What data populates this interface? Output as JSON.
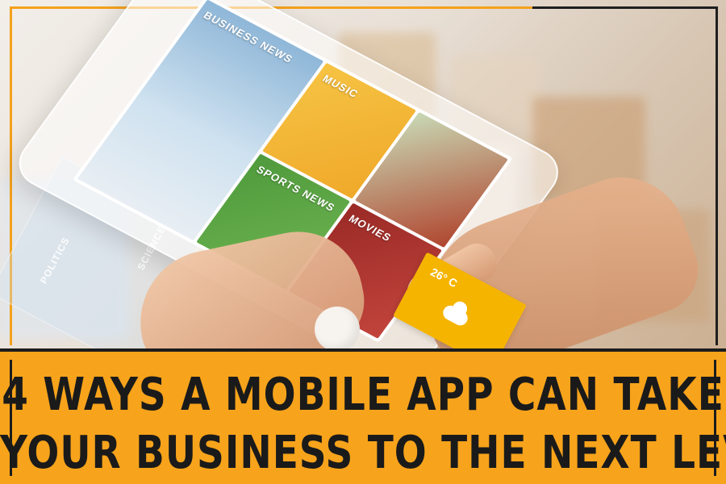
{
  "title": {
    "line1": "4 WAYS A MOBILE APP CAN TAKE",
    "line2": "YOUR BUSINESS TO THE NEXT LEVEL"
  },
  "phone_screen": {
    "tiles": [
      {
        "label": "BUSINESS NEWS"
      },
      {
        "label": "MUSIC"
      },
      {
        "label": "SPORTS NEWS"
      },
      {
        "label": "MOVIES"
      }
    ]
  },
  "side_panel": {
    "labels": [
      "SCIENCE",
      "POLITICS"
    ]
  },
  "weather_widget": {
    "temp": "26° C",
    "icon": "cloud-icon"
  },
  "colors": {
    "banner": "#f7a31b",
    "frame": "#f4a11c",
    "text": "#1a1a1a"
  }
}
